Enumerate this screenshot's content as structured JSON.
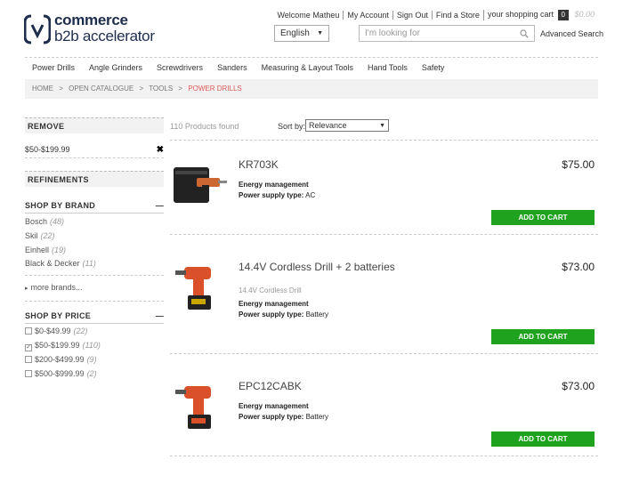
{
  "logo": {
    "line1": "commerce",
    "line2": "b2b accelerator"
  },
  "header": {
    "welcome": "Welcome Matheu",
    "my_account": "My Account",
    "sign_out": "Sign Out",
    "find_store": "Find a Store",
    "cart_label": "your shopping cart",
    "cart_count": "0",
    "cart_total": "$0.00",
    "language": "English",
    "search_placeholder": "I'm looking for",
    "advanced_search": "Advanced Search"
  },
  "nav": [
    "Power Drills",
    "Angle Grinders",
    "Screwdrivers",
    "Sanders",
    "Measuring & Layout Tools",
    "Hand Tools",
    "Safety"
  ],
  "breadcrumb": {
    "home": "HOME",
    "catalogue": "OPEN CATALOGUE",
    "tools": "TOOLS",
    "current": "POWER DRILLS",
    "sep": ">"
  },
  "sidebar": {
    "remove_title": "REMOVE",
    "remove_item": "$50-$199.99",
    "remove_icon": "close-icon",
    "refinements_title": "REFINEMENTS",
    "brand_title": "SHOP BY BRAND",
    "brands": [
      {
        "name": "Bosch",
        "count": "(48)"
      },
      {
        "name": "Skil",
        "count": "(22)"
      },
      {
        "name": "Einhell",
        "count": "(19)"
      },
      {
        "name": "Black & Decker",
        "count": "(11)"
      }
    ],
    "more_brands": "more brands...",
    "price_title": "SHOP BY PRICE",
    "prices": [
      {
        "label": "$0-$49.99",
        "count": "(22)",
        "checked": false
      },
      {
        "label": "$50-$199.99",
        "count": "(110)",
        "checked": true
      },
      {
        "label": "$200-$499.99",
        "count": "(9)",
        "checked": false
      },
      {
        "label": "$500-$999.99",
        "count": "(2)",
        "checked": false
      }
    ]
  },
  "results": {
    "found": "110 Products found",
    "sort_label": "Sort by:",
    "sort_value": "Relevance"
  },
  "products": [
    {
      "name": "KR703K",
      "price": "$75.00",
      "subtitle": "",
      "attr1_label": "Energy management",
      "attr2_label": "Power supply type:",
      "attr2_value": "AC",
      "button": "ADD TO CART"
    },
    {
      "name": "14.4V Cordless Drill + 2 batteries",
      "price": "$73.00",
      "subtitle": "14.4V Cordless Drill",
      "attr1_label": "Energy management",
      "attr2_label": "Power supply type:",
      "attr2_value": "Battery",
      "button": "ADD TO CART"
    },
    {
      "name": "EPC12CABK",
      "price": "$73.00",
      "subtitle": "",
      "attr1_label": "Energy management",
      "attr2_label": "Power supply type:",
      "attr2_value": "Battery",
      "button": "ADD TO CART"
    }
  ],
  "colors": {
    "accent_button": "#1fa31f",
    "breadcrumb_current": "#e05a5a",
    "logo": "#1f2d4d"
  }
}
